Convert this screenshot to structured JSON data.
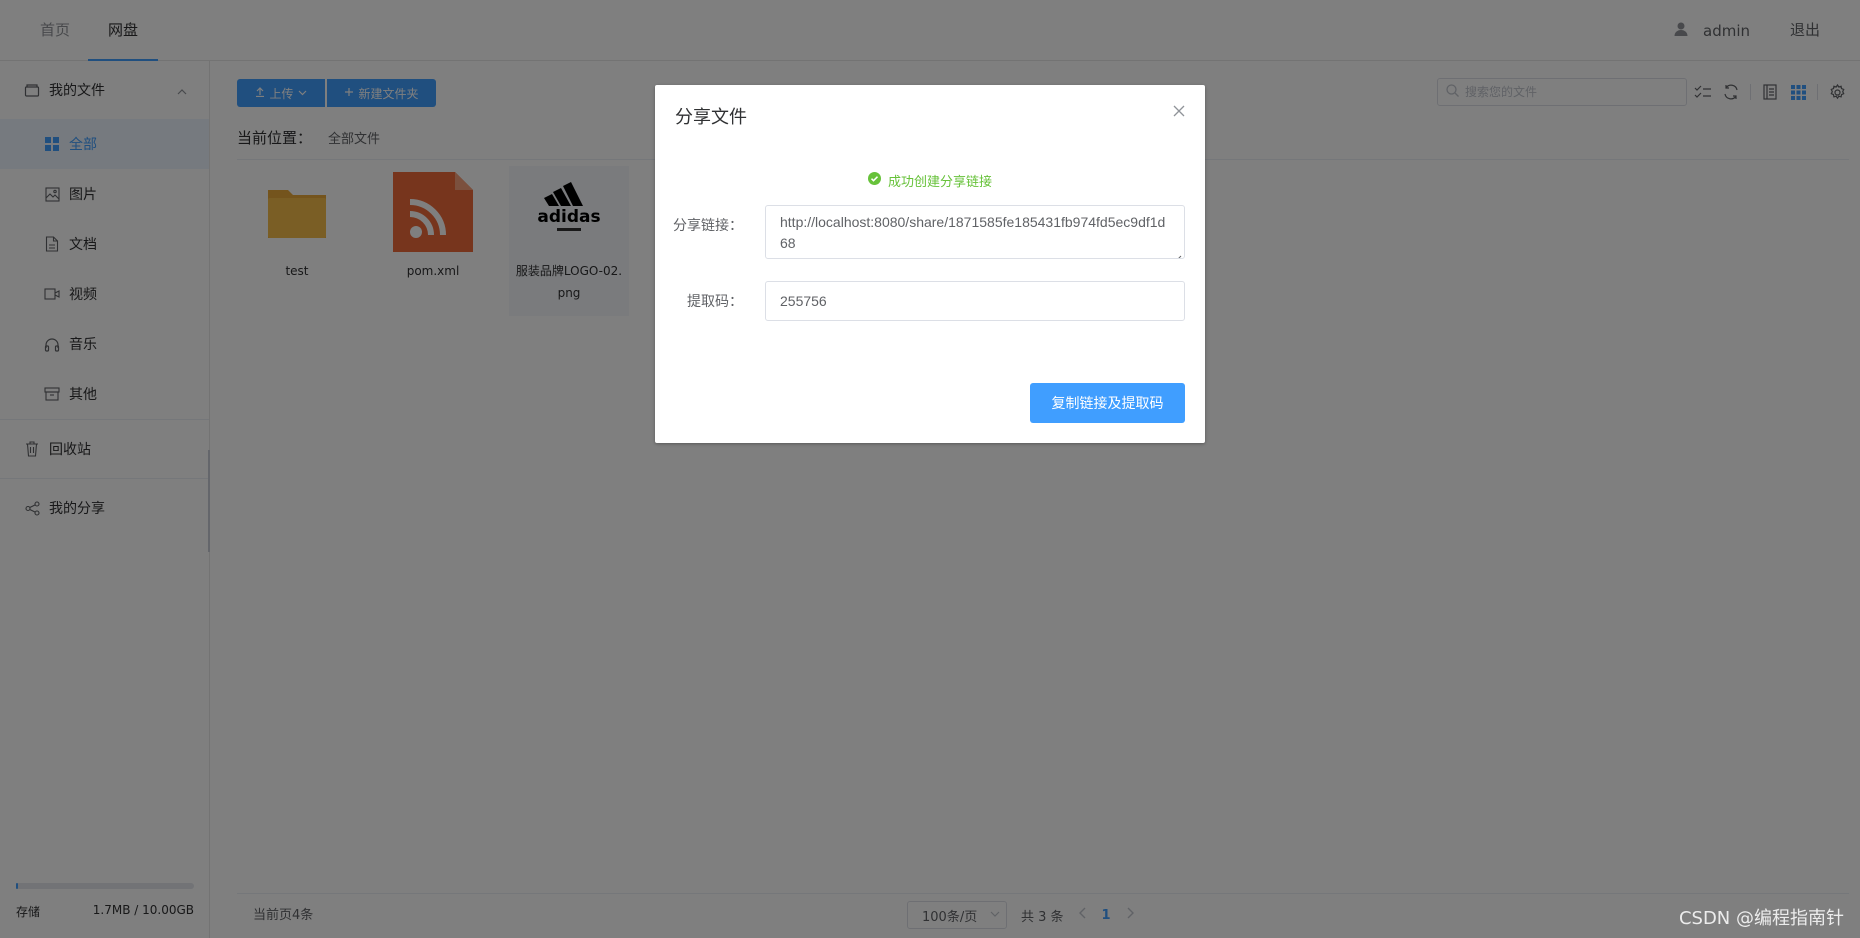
{
  "topbar": {
    "tabs": [
      {
        "label": "首页",
        "active": false
      },
      {
        "label": "网盘",
        "active": true
      }
    ],
    "username": "admin",
    "logout_label": "退出"
  },
  "sidebar": {
    "my_files_label": "我的文件",
    "items": [
      {
        "label": "全部",
        "icon": "grid-icon",
        "active": true
      },
      {
        "label": "图片",
        "icon": "image-icon"
      },
      {
        "label": "文档",
        "icon": "document-icon"
      },
      {
        "label": "视频",
        "icon": "video-icon"
      },
      {
        "label": "音乐",
        "icon": "headphones-icon"
      },
      {
        "label": "其他",
        "icon": "archive-icon"
      }
    ],
    "recycle_label": "回收站",
    "share_label": "我的分享",
    "storage": {
      "label": "存储",
      "value": "1.7MB / 10.00GB",
      "used_fraction": 0.0002
    }
  },
  "toolbar": {
    "upload_label": "上传",
    "new_folder_label": "新建文件夹",
    "search_placeholder": "搜索您的文件"
  },
  "breadcrumb": {
    "label": "当前位置：",
    "current": "全部文件"
  },
  "files": [
    {
      "name": "test",
      "type": "folder"
    },
    {
      "name": "pom.xml",
      "type": "xml"
    },
    {
      "name": "服装品牌LOGO-02.png",
      "type": "image"
    }
  ],
  "logo_text": "adidas",
  "footer": {
    "count_label": "当前页4条",
    "page_size": "100条/页",
    "total_label": "共 3 条",
    "current_page": "1"
  },
  "dialog": {
    "title": "分享文件",
    "success_message": "成功创建分享链接",
    "link_label": "分享链接：",
    "link_value": "http://localhost:8080/share/1871585fe185431fb974fd5ec9df1d68",
    "code_label": "提取码：",
    "code_value": "255756",
    "copy_button_label": "复制链接及提取码"
  },
  "watermark": "CSDN @编程指南针",
  "colors": {
    "primary": "#409eff",
    "success": "#67c23a",
    "overlay": "rgba(0,0,0,0.5)"
  }
}
